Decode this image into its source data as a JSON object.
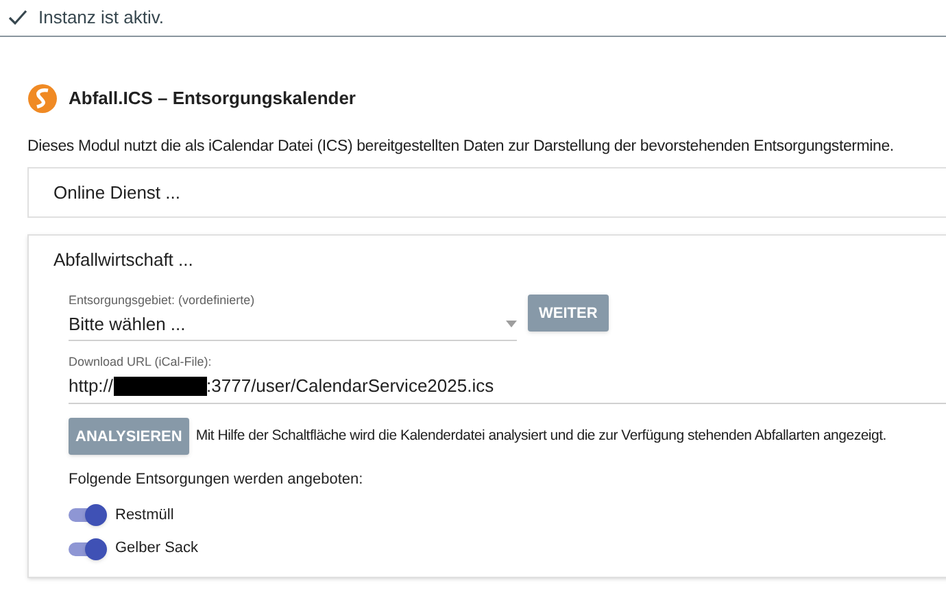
{
  "status": {
    "text": "Instanz ist aktiv."
  },
  "module": {
    "title": "Abfall.ICS – Entsorgungskalender",
    "description": "Dieses Modul nutzt die als iCalendar Datei (ICS) bereitgestellten Daten zur Darstellung der bevorstehenden Entsorgungstermine."
  },
  "panels": [
    {
      "title": "Online Dienst ...",
      "expanded": false
    },
    {
      "title": "Abfallwirtschaft ...",
      "expanded": true
    }
  ],
  "area_select": {
    "label": "Entsorgungsgebiet: (vordefinierte)",
    "value": "Bitte wählen ...",
    "button": "WEITER"
  },
  "url_field": {
    "label": "Download URL (iCal-File):",
    "value_start": "http://",
    "value_end": ":3777/user/CalendarService2025.ics",
    "redacted": true
  },
  "analyze": {
    "button": "ANALYSIEREN",
    "hint": "Mit Hilfe der Schaltfläche wird die Kalenderdatei analysiert und die zur Verfügung stehenden Abfallarten angezeigt."
  },
  "offered": {
    "heading": "Folgende Entsorgungen werden angeboten:",
    "items": [
      {
        "label": "Restmüll",
        "on": true
      },
      {
        "label": "Gelber Sack",
        "on": true
      }
    ]
  }
}
